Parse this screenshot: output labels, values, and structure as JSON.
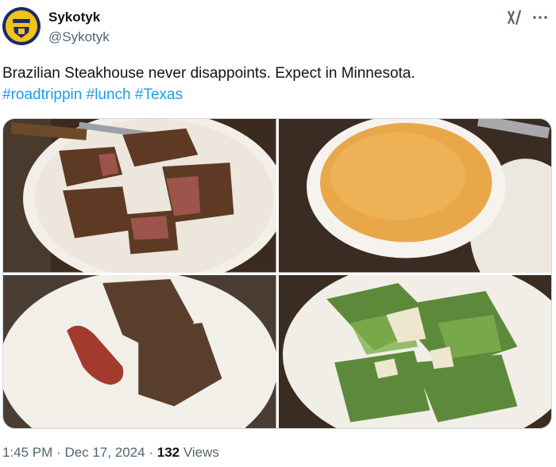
{
  "author": {
    "display_name": "Sykotyk",
    "handle": "@Sykotyk",
    "avatar_icon": "yellow-shield-avatar-icon"
  },
  "tweet": {
    "text": "Brazilian Steakhouse never disappoints. Expect in Minnesota.",
    "hashtags": [
      "#roadtrippin",
      "#lunch",
      "#Texas"
    ]
  },
  "media": [
    {
      "subject": "sliced steak on plate"
    },
    {
      "subject": "bowl of soup"
    },
    {
      "subject": "steak and sausage on plate"
    },
    {
      "subject": "caesar salad on plate"
    }
  ],
  "meta": {
    "time": "1:45 PM",
    "separator": "·",
    "date": "Dec 17, 2024",
    "views_count": "132",
    "views_label": "Views"
  },
  "colors": {
    "link": "#1d9bf0",
    "secondary_text": "#536471"
  }
}
